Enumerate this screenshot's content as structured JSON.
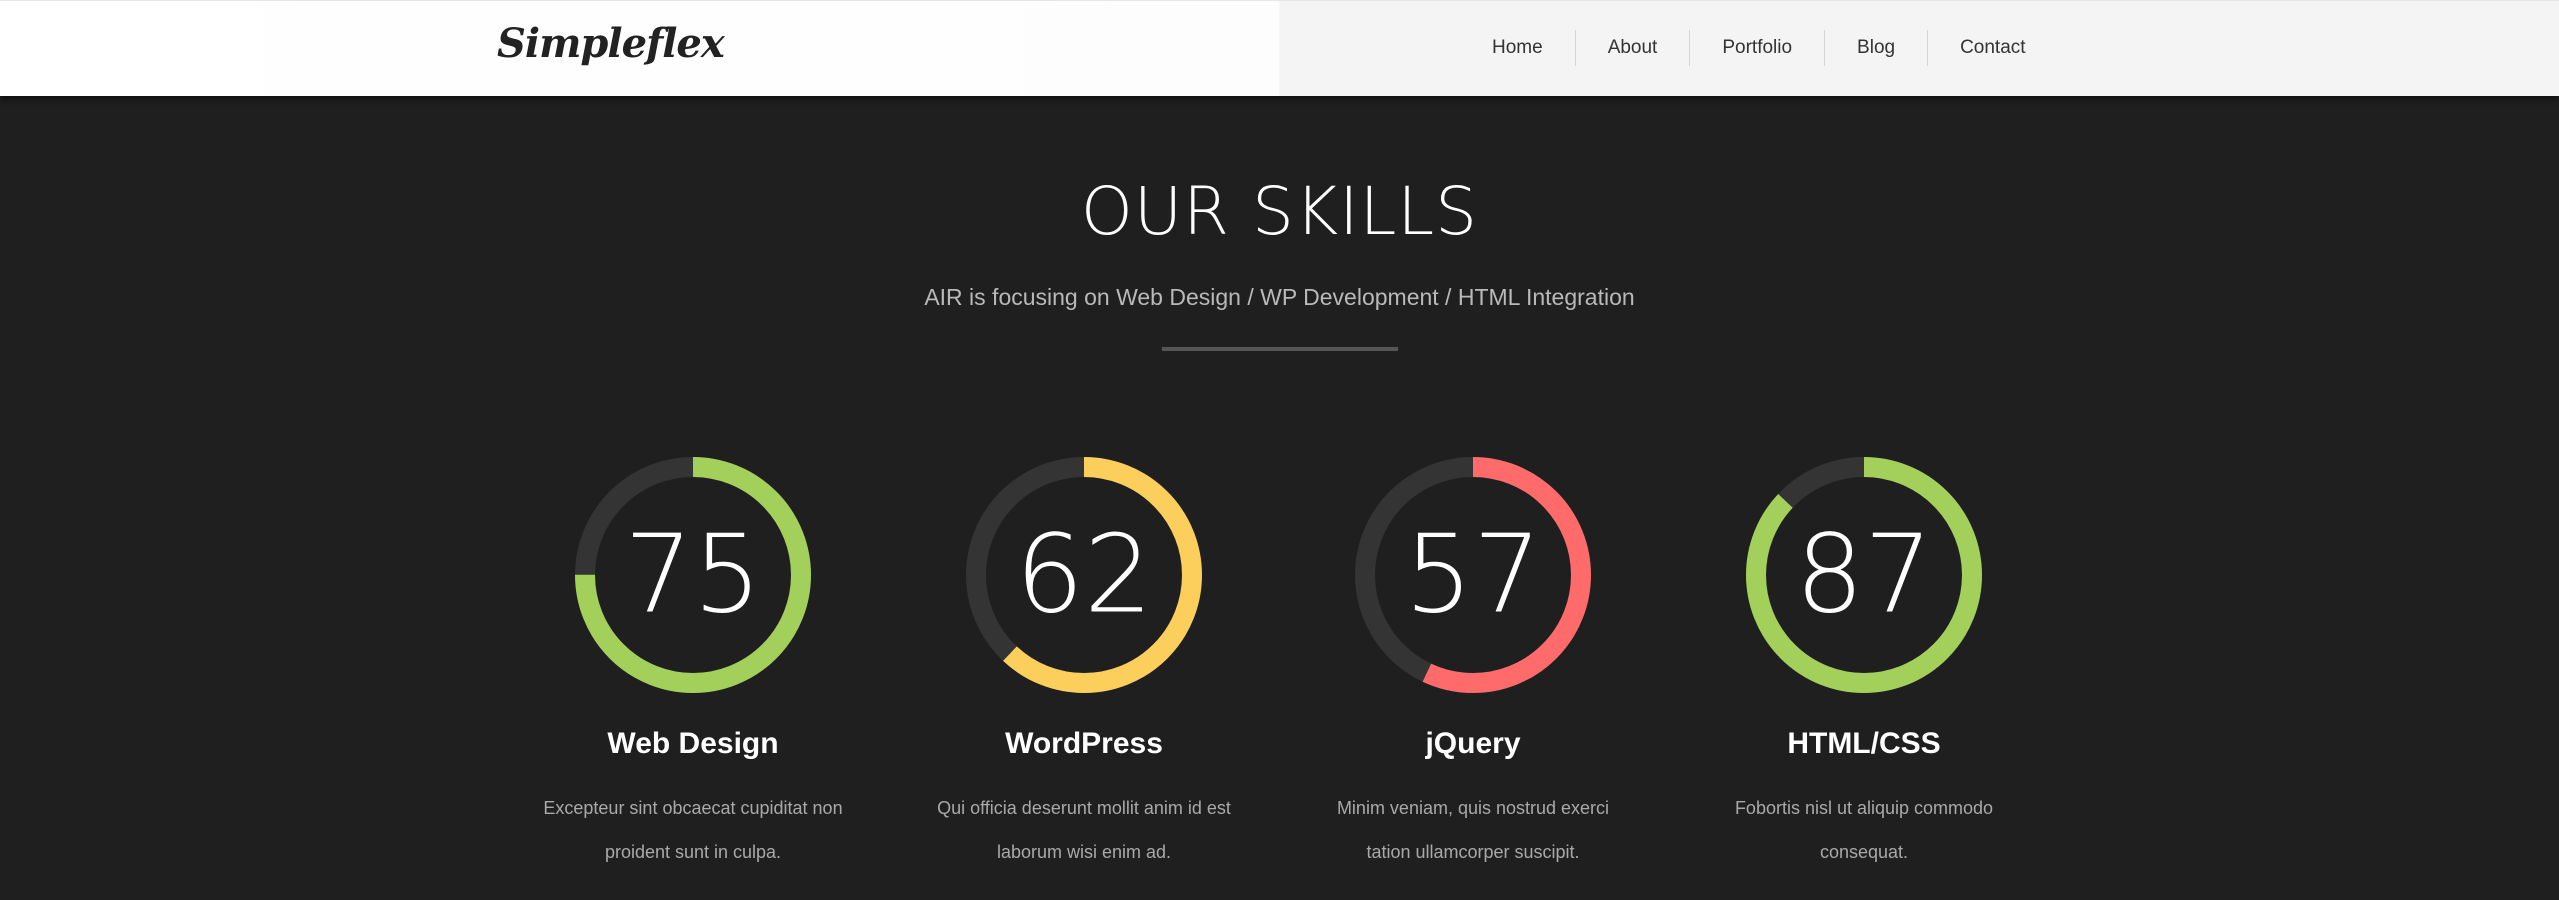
{
  "header": {
    "logo": "Simpleflex",
    "nav": [
      {
        "label": "Home"
      },
      {
        "label": "About"
      },
      {
        "label": "Portfolio"
      },
      {
        "label": "Blog"
      },
      {
        "label": "Contact"
      }
    ]
  },
  "skills_section": {
    "title": "OUR SKILLS",
    "subtitle": "AIR is focusing on Web Design / WP Development / HTML Integration",
    "skills": [
      {
        "value": "75",
        "percent": 75,
        "name": "Web Design",
        "desc_line1": "Excepteur sint obcaecat cupiditat non",
        "desc_line2": "proident sunt in culpa.",
        "color": "#a3d05b"
      },
      {
        "value": "62",
        "percent": 62,
        "name": "WordPress",
        "desc_line1": "Qui officia deserunt mollit anim id est",
        "desc_line2": "laborum wisi enim ad.",
        "color": "#fccf5c"
      },
      {
        "value": "57",
        "percent": 57,
        "name": "jQuery",
        "desc_line1": "Minim veniam, quis nostrud exerci",
        "desc_line2": "tation ullamcorper suscipit.",
        "color": "#ff6b6b"
      },
      {
        "value": "87",
        "percent": 87,
        "name": "HTML/CSS",
        "desc_line1": "Fobortis nisl ut aliquip commodo",
        "desc_line2": "consequat.",
        "color": "#a3d05b"
      }
    ]
  },
  "colors": {
    "background": "#1f1f1f",
    "ring_track": "#343434",
    "text": "#ffffff",
    "subtext": "#b9b9b9"
  }
}
